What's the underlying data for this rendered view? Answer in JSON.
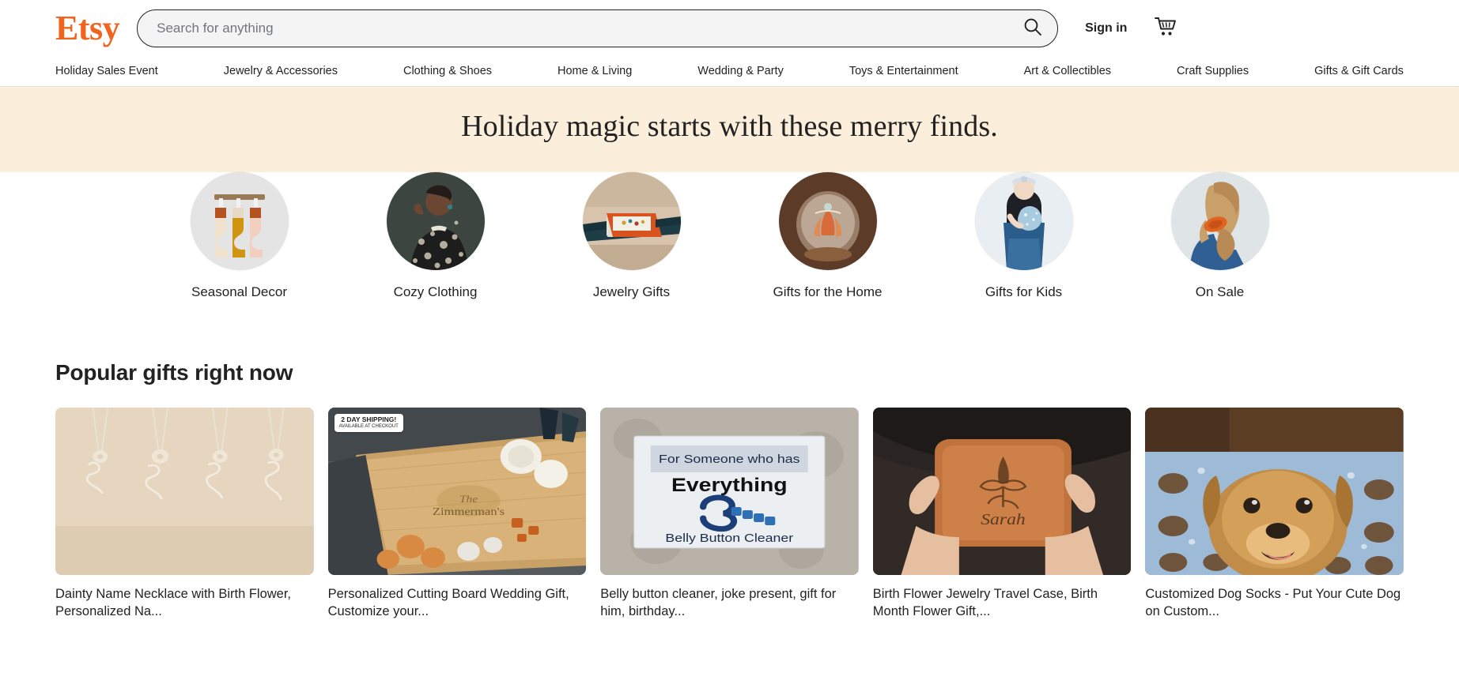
{
  "header": {
    "logo_text": "Etsy",
    "search_placeholder": "Search for anything",
    "search_value": "",
    "sign_in_label": "Sign in",
    "search_icon": "search-icon",
    "cart_icon": "shopping-cart-icon"
  },
  "nav": {
    "items": [
      {
        "label": "Holiday Sales Event"
      },
      {
        "label": "Jewelry & Accessories"
      },
      {
        "label": "Clothing & Shoes"
      },
      {
        "label": "Home & Living"
      },
      {
        "label": "Wedding & Party"
      },
      {
        "label": "Toys & Entertainment"
      },
      {
        "label": "Art & Collectibles"
      },
      {
        "label": "Craft Supplies"
      },
      {
        "label": "Gifts & Gift Cards"
      }
    ]
  },
  "hero": {
    "title": "Holiday magic starts with these merry finds.",
    "background_color": "#fbeedb"
  },
  "categories": [
    {
      "label": "Seasonal Decor",
      "image": "holiday-stockings-on-rack"
    },
    {
      "label": "Cozy Clothing",
      "image": "woman-in-patterned-top"
    },
    {
      "label": "Jewelry Gifts",
      "image": "orange-jewelry-box-with-earrings"
    },
    {
      "label": "Gifts for the Home",
      "image": "glass-dome-with-dried-flowers"
    },
    {
      "label": "Gifts for Kids",
      "image": "child-holding-plush-toy"
    },
    {
      "label": "On Sale",
      "image": "hair-with-orange-scrunchie"
    }
  ],
  "popular": {
    "section_title": "Popular gifts right now",
    "items": [
      {
        "title": "Dainty Name Necklace with Birth Flower, Personalized Na...",
        "image": "name-necklaces-on-beige-background",
        "badge": null
      },
      {
        "title": "Personalized Cutting Board Wedding Gift, Customize your...",
        "image": "engraved-cutting-board-with-cheese-and-wine",
        "badge": {
          "line1": "2 DAY",
          "line2": "SHIPPING!",
          "sub": "AVAILABLE AT CHECKOUT"
        }
      },
      {
        "title": "Belly button cleaner, joke present, gift for him, birthday...",
        "image": "belly-button-cleaner-gag-gift-card",
        "badge": null
      },
      {
        "title": "Birth Flower Jewelry Travel Case, Birth Month Flower Gift,...",
        "image": "leather-jewelry-case-engraved-sarah",
        "badge": null
      },
      {
        "title": "Customized Dog Socks - Put Your Cute Dog on Custom...",
        "image": "golden-retriever-with-custom-dog-socks",
        "badge": null
      }
    ]
  },
  "card_image_texts": {
    "cutting_board_engraving": "The Zimmerman's",
    "gag_gift_line1": "For Someone who has",
    "gag_gift_line2": "Everything",
    "gag_gift_line3": "Belly Button Cleaner",
    "jewelry_case_name": "Sarah"
  }
}
